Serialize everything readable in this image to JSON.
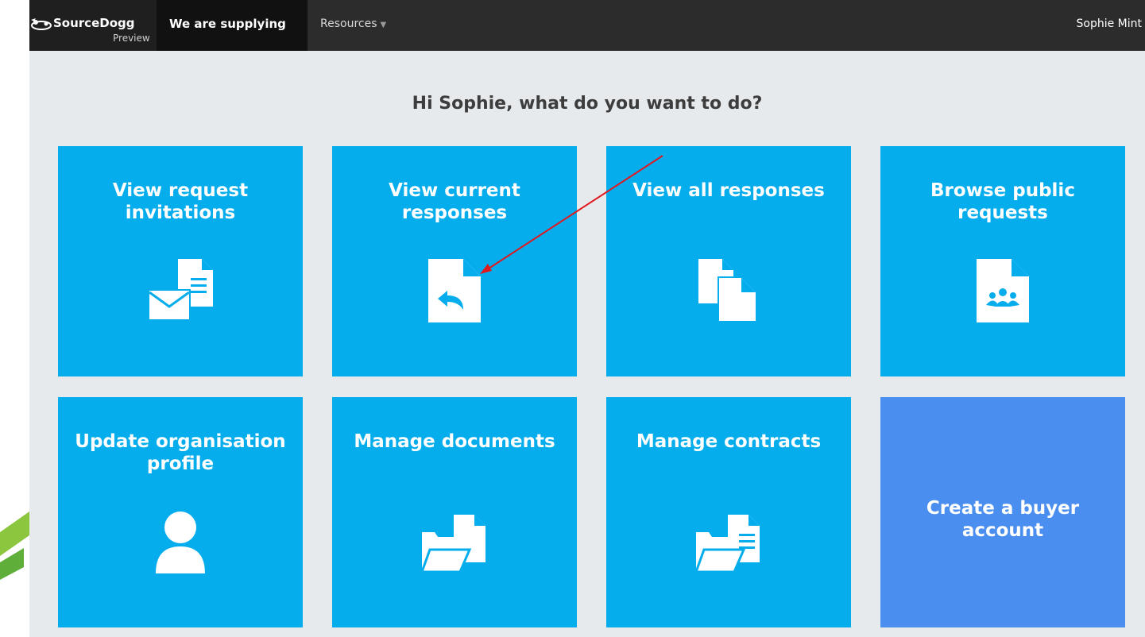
{
  "nav": {
    "brand": "SourceDogg",
    "brand_sub": "Preview",
    "active_item": "We are supplying",
    "resources_label": "Resources",
    "user_name": "Sophie Mint"
  },
  "main": {
    "greeting": "Hi Sophie, what do you want to do?",
    "tiles": [
      {
        "title": "View request invitations",
        "icon": "envelope-document-icon"
      },
      {
        "title": "View current responses",
        "icon": "document-reply-icon"
      },
      {
        "title": "View all responses",
        "icon": "documents-stack-icon"
      },
      {
        "title": "Browse public requests",
        "icon": "document-group-icon"
      },
      {
        "title": "Update organisation profile",
        "icon": "user-icon"
      },
      {
        "title": "Manage documents",
        "icon": "folder-document-icon"
      },
      {
        "title": "Manage contracts",
        "icon": "folder-contract-icon"
      },
      {
        "title": "Create a buyer account",
        "icon": ""
      }
    ]
  },
  "colors": {
    "tile": "#05aded",
    "buyer_tile": "#4a8ef0",
    "background": "#e7eaed",
    "navbar": "#2c2c2c",
    "annotation_arrow": "#e0191f"
  }
}
